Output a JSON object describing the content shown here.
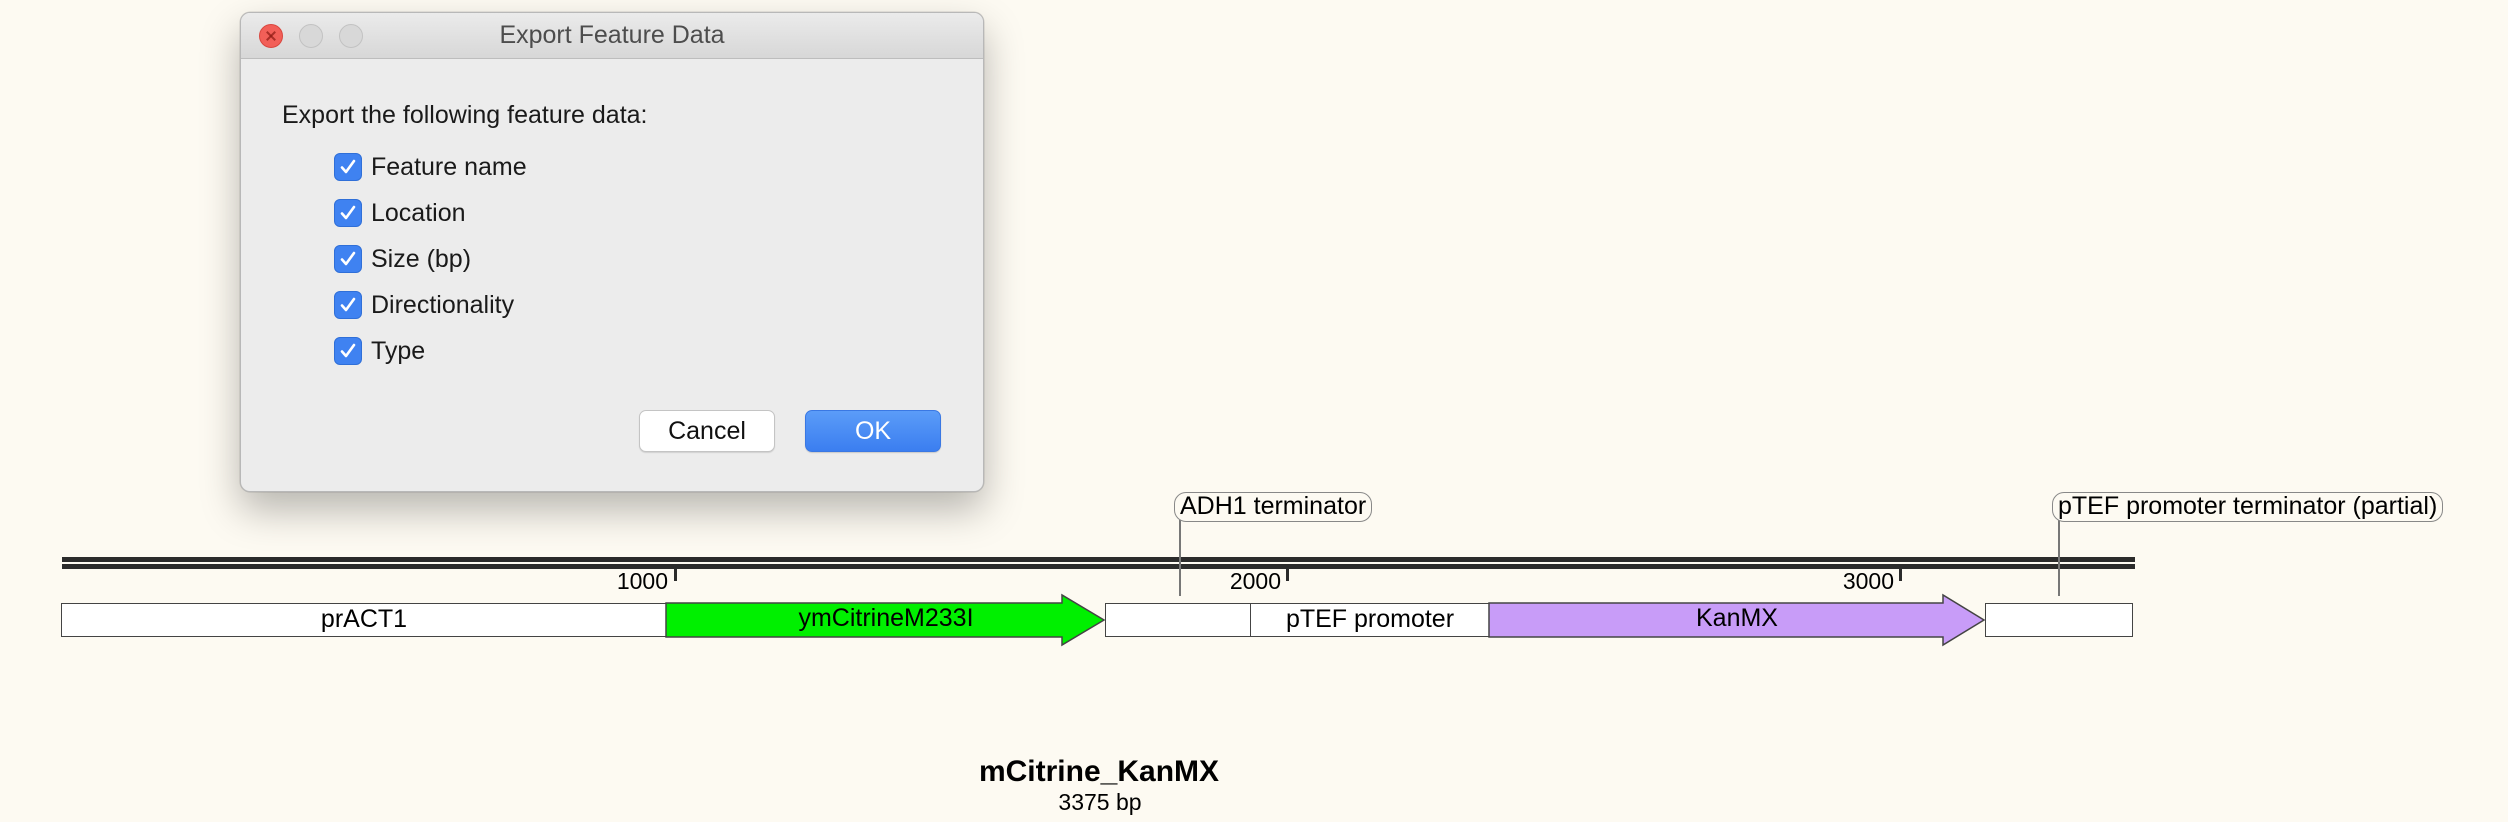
{
  "dialog": {
    "title": "Export Feature Data",
    "prompt": "Export the following feature data:",
    "options": [
      {
        "label": "Feature name",
        "checked": true
      },
      {
        "label": "Location",
        "checked": true
      },
      {
        "label": "Size (bp)",
        "checked": true
      },
      {
        "label": "Directionality",
        "checked": true
      },
      {
        "label": "Type",
        "checked": true
      }
    ],
    "cancel_label": "Cancel",
    "ok_label": "OK"
  },
  "map": {
    "ticks": [
      "1000",
      "2000",
      "3000"
    ],
    "features": [
      {
        "name": "prACT1",
        "color": "#ffffff"
      },
      {
        "name": "ymCitrineM233I",
        "color": "#00f000"
      },
      {
        "name": "pTEF promoter",
        "color": "#ffffff"
      },
      {
        "name": "KanMX",
        "color": "#c89cf8"
      }
    ],
    "callouts": [
      "ADH1 terminator",
      "pTEF promoter terminator (partial)"
    ]
  },
  "sequence": {
    "name": "mCitrine_KanMX",
    "length": "3375 bp"
  },
  "colors": {
    "background": "#fdfaf2",
    "accent": "#3f82f1",
    "close_button": "#f25f58"
  }
}
